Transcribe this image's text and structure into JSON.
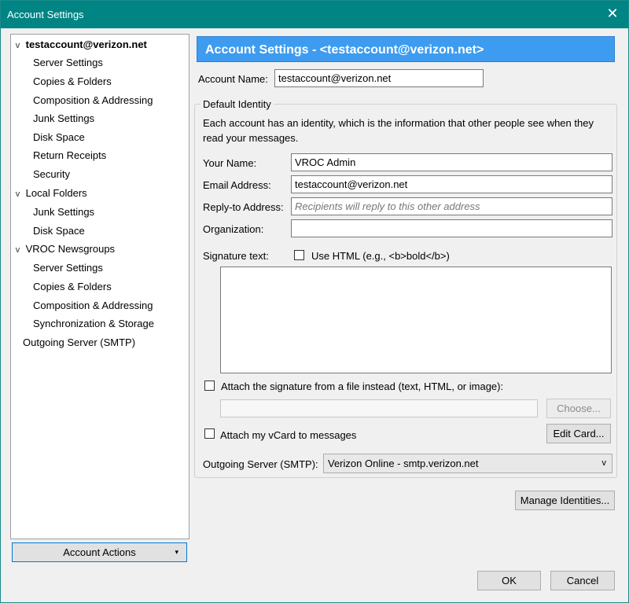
{
  "window": {
    "title": "Account Settings",
    "close_glyph": "✕"
  },
  "tree": {
    "chevron": "v",
    "account": "testaccount@verizon.net",
    "account_items": [
      "Server Settings",
      "Copies & Folders",
      "Composition & Addressing",
      "Junk Settings",
      "Disk Space",
      "Return Receipts",
      "Security"
    ],
    "local": "Local Folders",
    "local_items": [
      "Junk Settings",
      "Disk Space"
    ],
    "news": "VROC Newsgroups",
    "news_items": [
      "Server Settings",
      "Copies & Folders",
      "Composition & Addressing",
      "Synchronization & Storage"
    ],
    "smtp": "Outgoing Server (SMTP)"
  },
  "account_actions": {
    "label": "Account Actions",
    "arrow": "▾"
  },
  "panel": {
    "header": "Account Settings - <testaccount@verizon.net>",
    "account_name_label": "Account Name:",
    "account_name_value": "testaccount@verizon.net",
    "group_label": "Default Identity",
    "description": "Each account has an identity, which is the information that other people see when they read your messages.",
    "your_name_label": "Your Name:",
    "your_name_value": "VROC Admin",
    "email_label": "Email Address:",
    "email_value": "testaccount@verizon.net",
    "replyto_label": "Reply-to Address:",
    "replyto_placeholder": "Recipients will reply to this other address",
    "org_label": "Organization:",
    "org_value": "",
    "signature_label": "Signature text:",
    "use_html_label": "Use HTML (e.g., <b>bold</b>)",
    "attach_sig_label": "Attach the signature from a file instead (text, HTML, or image):",
    "choose_label": "Choose...",
    "attach_vcard_label": "Attach my vCard to messages",
    "edit_card_label": "Edit Card...",
    "smtp_label": "Outgoing Server (SMTP):",
    "smtp_value": "Verizon Online - smtp.verizon.net",
    "manage_identities_label": "Manage Identities..."
  },
  "footer": {
    "ok_label": "OK",
    "cancel_label": "Cancel"
  }
}
